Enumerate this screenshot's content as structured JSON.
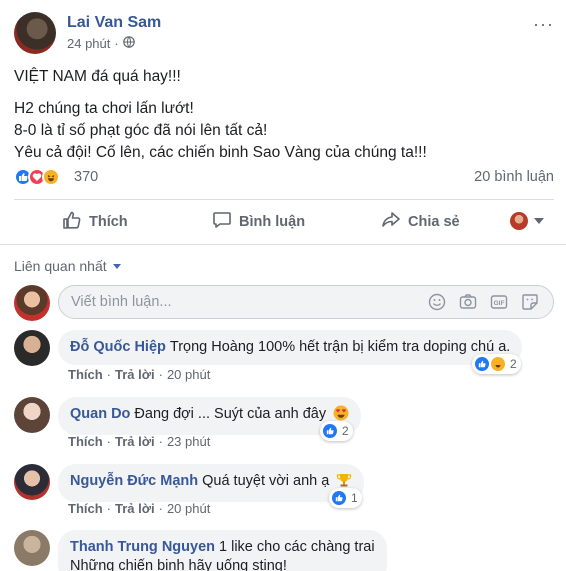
{
  "post": {
    "author": "Lai Van Sam",
    "time": "24 phút",
    "privacy_icon": "globe-icon",
    "more_label": "···",
    "lines": [
      "VIỆT NAM đá quá hay!!!",
      "H2 chúng ta chơi lấn lướt!",
      "8-0 là tỉ số phạt góc đã nói lên tất cả!",
      "Yêu cả đội! Cố lên, các chiến binh Sao Vàng của chúng ta!!!"
    ],
    "reaction_count": "370",
    "comment_count": "20 bình luận"
  },
  "actions": {
    "like": "Thích",
    "comment": "Bình luận",
    "share": "Chia sẻ"
  },
  "comments_section": {
    "sort_label": "Liên quan nhất",
    "composer_placeholder": "Viết bình luận..."
  },
  "labels": {
    "like": "Thích",
    "reply": "Trả lời",
    "sep": "·"
  },
  "comments": [
    {
      "name": "Đỗ Quốc Hiệp",
      "text": "Trọng Hoàng 100% hết trận bị kiểm tra doping chú a.",
      "time": "20 phút",
      "react_count": "2"
    },
    {
      "name": "Quan Do",
      "text": "Đang đợi ... Suýt của anh đây",
      "time": "23 phút",
      "react_count": "2"
    },
    {
      "name": "Nguyễn Đức Mạnh",
      "text": "Quá tuyệt vời anh ạ",
      "time": "20 phút",
      "react_count": "1"
    },
    {
      "name": "Thanh Trung Nguyen",
      "text": "1 like cho các chàng trai",
      "text2": "Những chiến binh hãy uống sting!"
    }
  ],
  "colors": {
    "link_blue": "#385898",
    "like_blue": "#2078f4",
    "love_red": "#f33e58",
    "haha_yellow": "#f7b125",
    "muted_gray": "#606770",
    "bubble_bg": "#f2f3f5"
  }
}
